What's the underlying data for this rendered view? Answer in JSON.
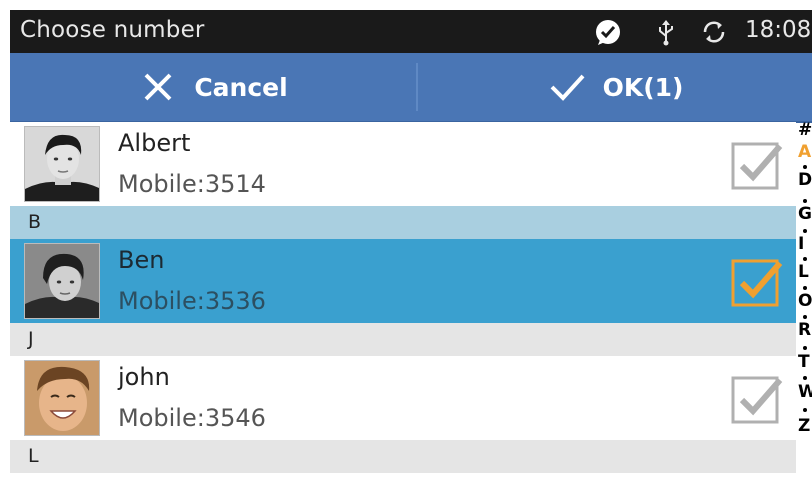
{
  "status_bar": {
    "title": "Choose number",
    "time": "18:08",
    "icons": [
      "chat-bubble-check-icon",
      "usb-icon",
      "sync-icon"
    ]
  },
  "action_bar": {
    "cancel_label": "Cancel",
    "ok_label": "OK(1)",
    "color": "#4a76b5"
  },
  "contacts": [
    {
      "name": "Albert",
      "phone": "Mobile:3514",
      "checked": false
    },
    {
      "name": "Ben",
      "phone": "Mobile:3536",
      "checked": true
    },
    {
      "name": "john",
      "phone": "Mobile:3546",
      "checked": false
    }
  ],
  "sections": [
    "B",
    "J",
    "L"
  ],
  "alphabet": [
    "#",
    "A",
    "D",
    "G",
    "I",
    "L",
    "O",
    "R",
    "T",
    "W",
    "Z"
  ],
  "active_letter": "A",
  "colors": {
    "selected_row": "#3aa0cf",
    "check_active": "#f0a030",
    "check_inactive": "#b0b0b0"
  }
}
